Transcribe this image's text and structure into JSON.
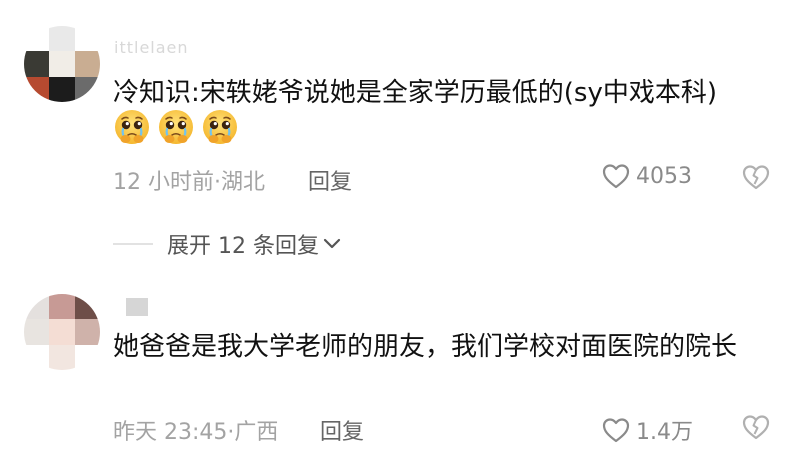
{
  "comments": [
    {
      "username": "ittlelaen",
      "avatar_colors": [
        "#ffffff",
        "#e9e9e9",
        "#ffffff",
        "#3a3a34",
        "#f1ede7",
        "#c9ad92",
        "#b64a30",
        "#1c1c1c",
        "#6b6b6b"
      ],
      "text": "冷知识:宋轶姥爷说她是全家学历最低的(sy中戏本科)",
      "emojis": [
        "pleading-face-icon",
        "pleading-face-icon",
        "pleading-face-icon"
      ],
      "time": "12 小时前",
      "separator": "·",
      "location": "湖北",
      "reply_label": "回复",
      "like_count": "4053"
    },
    {
      "username": "",
      "avatar_colors": [
        "#e4e0de",
        "#c79a95",
        "#6e4e48",
        "#e8e4e0",
        "#f4ddd4",
        "#cfb2aa",
        "#ffffff",
        "#f2e6e0",
        "#ffffff"
      ],
      "text": "她爸爸是我大学老师的朋友，我们学校对面医院的院长",
      "time": "昨天 23:45",
      "separator": "·",
      "location": "广西",
      "reply_label": "回复",
      "like_count": "1.4万"
    }
  ],
  "expand": {
    "label": "展开 12 条回复"
  },
  "colors": {
    "text": "#111111",
    "meta": "#a3a3a3",
    "icon": "#8a8a8a"
  }
}
